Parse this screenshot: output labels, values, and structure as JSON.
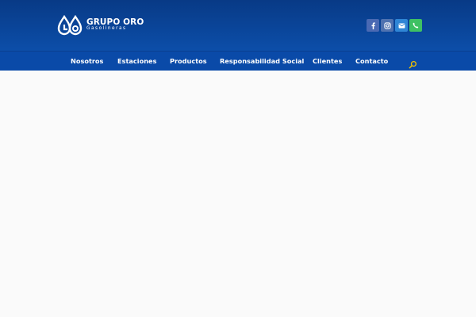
{
  "brand": {
    "title": "GRUPO ORO",
    "subtitle": "Gasolineras",
    "logo_icon": "droplets-logo-icon"
  },
  "social": [
    {
      "name": "facebook",
      "icon": "facebook-icon",
      "color": "#3b5998"
    },
    {
      "name": "instagram",
      "icon": "instagram-icon",
      "color": "#4a6fa8"
    },
    {
      "name": "email",
      "icon": "envelope-icon",
      "color": "#2f86d6"
    },
    {
      "name": "phone",
      "icon": "phone-icon",
      "color": "#3fbf5f"
    }
  ],
  "nav": {
    "items": [
      {
        "label": "Nosotros"
      },
      {
        "label": "Estaciones"
      },
      {
        "label": "Productos"
      },
      {
        "label": "Responsabilidad Social"
      },
      {
        "label": "Clientes"
      },
      {
        "label": "Contacto"
      }
    ],
    "search_icon": "search-icon"
  },
  "colors": {
    "header_top": "#083a86",
    "header_bottom": "#0c4ea9",
    "nav_bg": "#0a4aa8",
    "accent": "#f2c200"
  }
}
